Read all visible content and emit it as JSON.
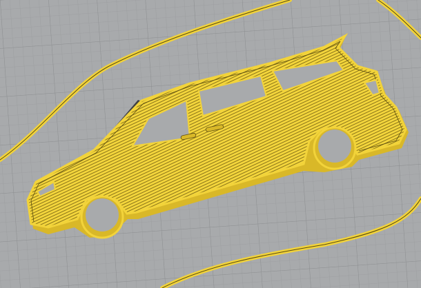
{
  "scene": {
    "view": "sliced-layer-preview",
    "object": "car-silhouette-keychain",
    "colors": {
      "bed": "#a8aaac",
      "grid": "#969899",
      "filament": "#f2d33a",
      "filament_dark": "#6b5a10",
      "shadow": "#3f4042"
    }
  }
}
